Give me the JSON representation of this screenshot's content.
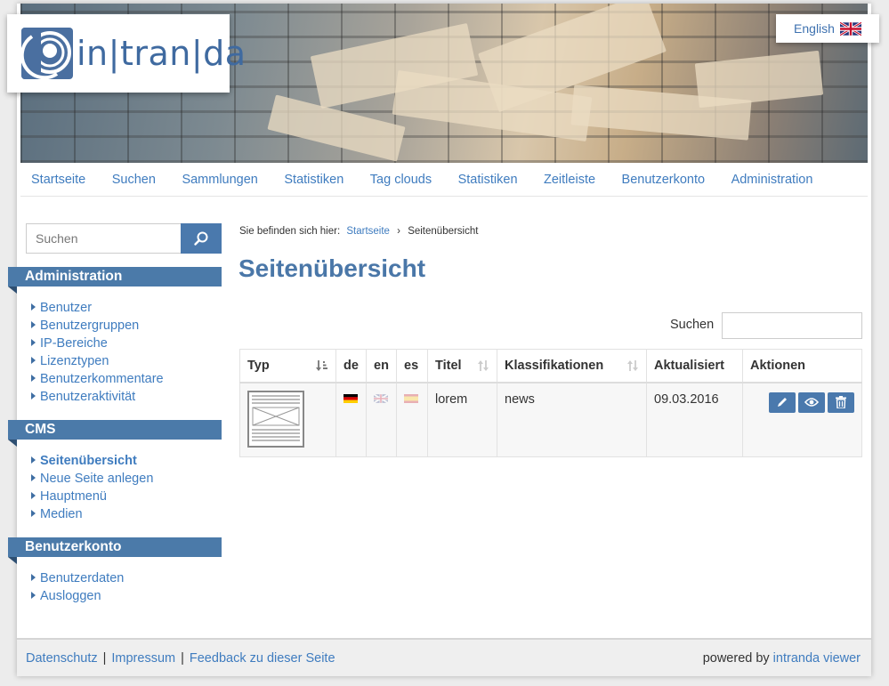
{
  "brand": {
    "logo_text": "in|tran|da"
  },
  "language": {
    "label": "English"
  },
  "nav": {
    "items": [
      "Startseite",
      "Suchen",
      "Sammlungen",
      "Statistiken",
      "Tag clouds",
      "Statistiken",
      "Zeitleiste",
      "Benutzerkonto",
      "Administration"
    ]
  },
  "sidebar": {
    "search": {
      "placeholder": "Suchen"
    },
    "sections": [
      {
        "title": "Administration",
        "items": [
          "Benutzer",
          "Benutzergruppen",
          "IP-Bereiche",
          "Lizenztypen",
          "Benutzerkommentare",
          "Benutzeraktivität"
        ]
      },
      {
        "title": "CMS",
        "items": [
          "Seitenübersicht",
          "Neue Seite anlegen",
          "Hauptmenü",
          "Medien"
        ],
        "active": "Seitenübersicht"
      },
      {
        "title": "Benutzerkonto",
        "items": [
          "Benutzerdaten",
          "Ausloggen"
        ]
      }
    ]
  },
  "breadcrumb": {
    "prefix": "Sie befinden sich hier:",
    "home": "Startseite",
    "separator": "›",
    "current": "Seitenübersicht"
  },
  "main": {
    "title": "Seitenübersicht",
    "table_search_label": "Suchen",
    "columns": [
      "Typ",
      "de",
      "en",
      "es",
      "Titel",
      "Klassifikationen",
      "Aktualisiert",
      "Aktionen"
    ],
    "rows": [
      {
        "title": "lorem",
        "classification": "news",
        "updated": "09.03.2016",
        "langs": {
          "de": "active",
          "en": "inactive",
          "es": "inactive"
        }
      }
    ]
  },
  "footer": {
    "links": [
      "Datenschutz",
      "Impressum",
      "Feedback zu dieser Seite"
    ],
    "powered_by": "powered by",
    "powered_link": "intranda viewer"
  },
  "colors": {
    "accent": "#4b7aa9",
    "link": "#3f7cbf",
    "button": "#4a79ad"
  }
}
